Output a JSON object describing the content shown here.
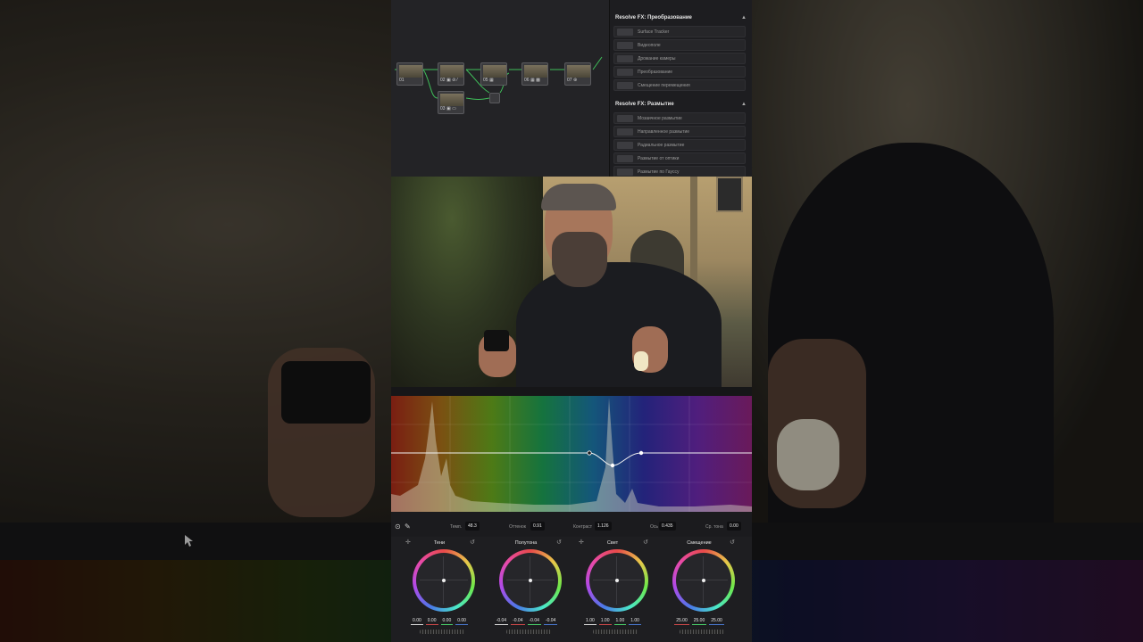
{
  "nodes": [
    "01",
    "02 ▣ ⊘ ⁄",
    "05 ▦",
    "06 ▦ ▩",
    "07 ⊛",
    "03 ▣ ▭"
  ],
  "effects": {
    "groups": [
      {
        "title": "Resolve FX: Преобразование",
        "items": [
          "Surface Tracker",
          "Видеополе",
          "Дрожание камеры",
          "Преобразование",
          "Смещение перемещения"
        ]
      },
      {
        "title": "Resolve FX: Размытие",
        "items": [
          "Мозаичное размытие",
          "Направленное размытие",
          "Радиальное размытие",
          "Размытие от оптики",
          "Размытие по Гауссу"
        ]
      }
    ]
  },
  "controls": {
    "temp_label": "Темп.",
    "temp_value": "48.3",
    "tint_label": "Оттенок",
    "tint_value": "0.91",
    "contrast_label": "Контраст",
    "contrast_value": "1.126",
    "pivot_label": "Ось",
    "pivot_value": "0.435",
    "md_label": "Ср. тона",
    "md_value": "0.00"
  },
  "wheels": [
    {
      "title": "Тени",
      "values": [
        "0.00",
        "0.00",
        "0.00",
        "0.00"
      ]
    },
    {
      "title": "Полутона",
      "values": [
        "-0.04",
        "-0.04",
        "-0.04",
        "-0.04"
      ]
    },
    {
      "title": "Свет",
      "values": [
        "1.00",
        "1.00",
        "1.00",
        "1.00"
      ]
    },
    {
      "title": "Смещение",
      "values": [
        "25.00",
        "25.00",
        "25.00"
      ]
    }
  ],
  "colors": {
    "panel_bg": "#1b1b1e",
    "node_link": "#3fbf5a",
    "curve_line": "#f2f2f2"
  }
}
